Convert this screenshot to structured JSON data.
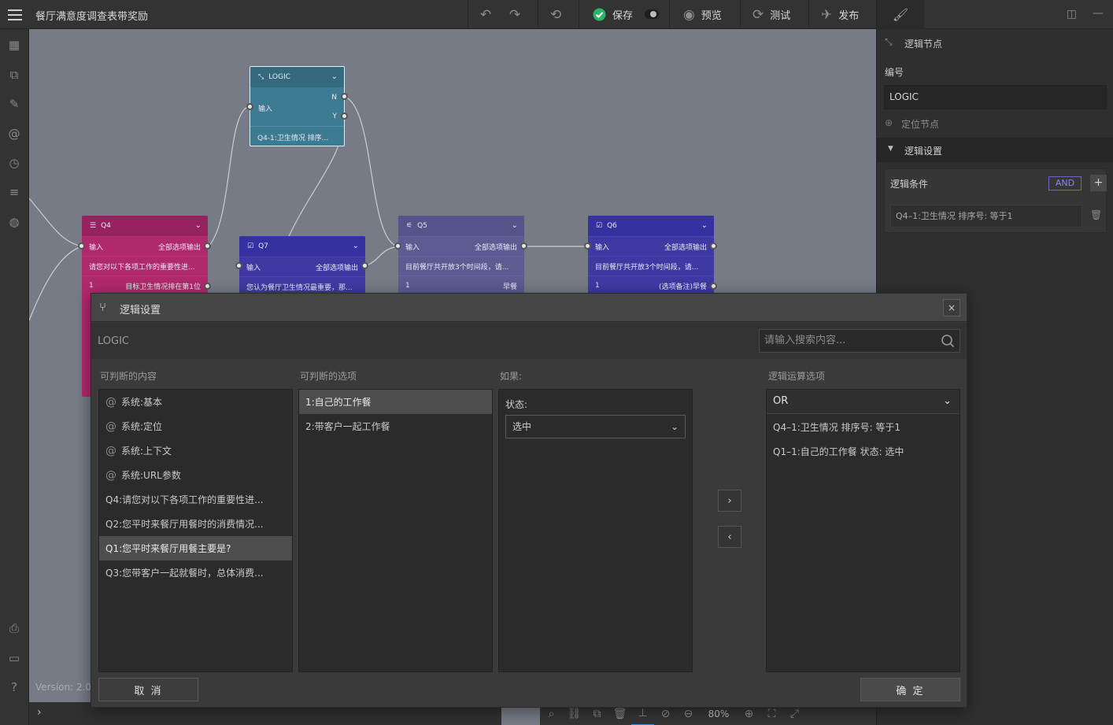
{
  "app": {
    "title": "餐厅满意度调查表带奖励"
  },
  "toolbar": {
    "save": "保存",
    "preview": "预览",
    "test": "测试",
    "publish": "发布"
  },
  "canvas": {
    "version": "Version: 2.0",
    "zoom": "80%",
    "nodes": {
      "logic": {
        "title": "LOGIC",
        "input": "输入",
        "n": "N",
        "y": "Y",
        "summary": "Q4-1:卫生情况 排序..."
      },
      "q4": {
        "title": "Q4",
        "input": "输入",
        "output": "全部选项输出",
        "desc": "请您对以下各项工作的重要性进...",
        "opt_num": "1",
        "opt_text": "目标卫生情况排在第1位"
      },
      "q7": {
        "title": "Q7",
        "input": "输入",
        "output": "全部选项输出",
        "desc": "您认为餐厅卫生情况最重要，那..."
      },
      "q5": {
        "title": "Q5",
        "input": "输入",
        "output": "全部选项输出",
        "desc": "目前餐厅共开放3个时间段，请...",
        "opt_num": "1",
        "opt_text": "早餐"
      },
      "q6": {
        "title": "Q6",
        "input": "输入",
        "output": "全部选项输出",
        "desc": "目前餐厅共开放3个时间段，请...",
        "opt_num": "1",
        "opt_text": "(选项备注)早餐"
      }
    }
  },
  "rightpanel": {
    "node_type": "逻辑节点",
    "id_label": "编号",
    "id_value": "LOGIC",
    "locate": "定位节点",
    "section": "逻辑设置",
    "cond_label": "逻辑条件",
    "and_label": "AND",
    "add_label": "+",
    "condition": "Q4–1:卫生情况 排序号: 等于1"
  },
  "modal": {
    "title": "逻辑设置",
    "close": "×",
    "logic_name": "LOGIC",
    "search_placeholder": "请输入搜索内容...",
    "col1_head": "可判断的内容",
    "col2_head": "可判断的选项",
    "col3_head": "如果:",
    "col4_head": "逻辑运算选项",
    "contents": [
      {
        "label": "系统:基本",
        "icon": "at-icon"
      },
      {
        "label": "系统:定位",
        "icon": "at-icon"
      },
      {
        "label": "系统:上下文",
        "icon": "at-icon"
      },
      {
        "label": "系统:URL参数",
        "icon": "at-icon"
      },
      {
        "label": "Q4:请您对以下各项工作的重要性进..."
      },
      {
        "label": "Q2:您平时来餐厅用餐时的消费情况..."
      },
      {
        "label": "Q1:您平时来餐厅用餐主要是?"
      },
      {
        "label": "Q3:您带客户一起就餐时，总体消费..."
      }
    ],
    "options": [
      "1:自己的工作餐",
      "2:带客户一起工作餐"
    ],
    "state_label": "状态:",
    "state_value": "选中",
    "operator": "OR",
    "results": [
      "Q4–1:卫生情况 排序号: 等于1",
      "Q1–1:自己的工作餐 状态: 选中"
    ],
    "cancel": "取 消",
    "confirm": "确 定"
  },
  "colors": {
    "logic_node": "#3d7b92",
    "q4_node": "#b0296c",
    "q7_node": "#3f3aa3",
    "q5_node": "#5e5a92",
    "q6_node": "#3f3aa3",
    "accent_green": "#2fb36b",
    "and_purple": "#6e63c6"
  }
}
